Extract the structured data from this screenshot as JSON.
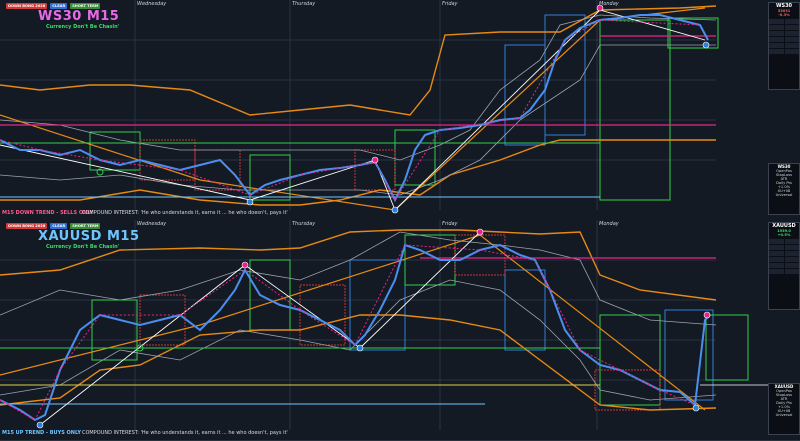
{
  "top": {
    "symbol_title": "WS30 M15",
    "subtitle": "Currency Don't Be Chasin'",
    "tags": [
      {
        "label": "DOWN BONG 2026",
        "color": "#d23a3a"
      },
      {
        "label": "CLEAR",
        "color": "#2f6fd1"
      },
      {
        "label": "SHORT TERM",
        "color": "#3a8a3a"
      }
    ],
    "days": [
      "Wednesday",
      "Thursday",
      "Friday",
      "Monday"
    ],
    "trend_text": "M15 DOWN TREND - SELLS ONLY",
    "quote": "COMPOUND INTEREST: 'He who understands it, earns it ... he who doesn't, pays it'",
    "side_symbol": "WS30",
    "side_price": "33031",
    "side_change": "-0.3%",
    "side2_title": "WS30",
    "side2_items": [
      "OpenPos",
      "StopLoss",
      "ATR",
      "Daily Pts",
      "+1.0%",
      "XU+08",
      "Universal"
    ]
  },
  "bottom": {
    "symbol_title": "XAUUSD M15",
    "subtitle": "Currency Don't Be Chasin'",
    "tags": [
      {
        "label": "DOWN BONG 2026",
        "color": "#d23a3a"
      },
      {
        "label": "CLEAR",
        "color": "#2f6fd1"
      },
      {
        "label": "SHORT TERM",
        "color": "#3a8a3a"
      }
    ],
    "days": [
      "Wednesday",
      "Thursday",
      "Friday",
      "Monday"
    ],
    "trend_text": "M15 UP TREND - BUYS ONLY",
    "quote": "COMPOUND INTEREST: 'He who understands it, earns it ... he who doesn't, pays it'",
    "side_symbol": "XAUUSD",
    "side_price": "1939.0",
    "side_change": "+0.5%",
    "side2_title": "XAUUSD",
    "side2_items": [
      "OpenPos",
      "StopLoss",
      "ATR",
      "Daily Pts",
      "+1.0%",
      "XU+08",
      "Universal"
    ]
  },
  "colors": {
    "bg": "#141a24",
    "orange": "#e88a12",
    "pink": "#e8248c",
    "green": "#2fcf4a",
    "blue": "#2f7fd8",
    "white": "#ffffff",
    "grey": "#9aa3ae",
    "red": "#c9333a"
  }
}
